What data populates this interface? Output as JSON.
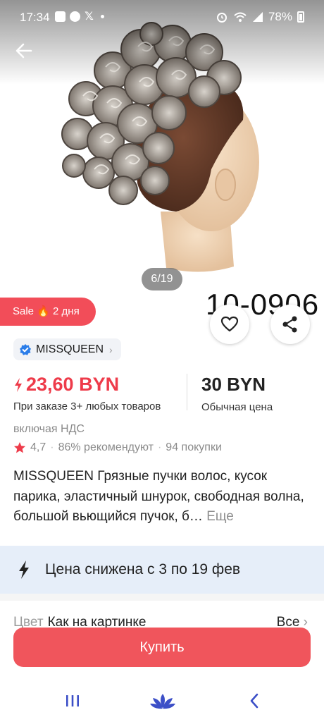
{
  "status_bar": {
    "time": "17:34",
    "battery": "78%"
  },
  "gallery": {
    "counter": "6/19",
    "watermark_text": "10-0906"
  },
  "sale_tag": {
    "label": "Sale 🔥 2 дня"
  },
  "store": {
    "name": "MISSQUEEN"
  },
  "price": {
    "sale": "23,60 BYN",
    "sale_note": "При заказе 3+ любых товаров",
    "regular": "30 BYN",
    "regular_note": "Обычная цена"
  },
  "vat": "включая НДС",
  "rating": {
    "value": "4,7",
    "recommend": "86% рекомендуют",
    "purchases": "94 покупки",
    "separator": "·"
  },
  "description": {
    "text": "MISSQUEEN Грязные пучки волос, кусок парика, эластичный шнурок, свободная волна, большой вьющийся пучок, б…",
    "more": "Еще"
  },
  "banner": {
    "text": "Цена снижена с 3 по 19 фев"
  },
  "color_row": {
    "label": "Цвет",
    "value": "Как на картинке",
    "all": "Все"
  },
  "buy_button": {
    "label": "Купить"
  },
  "colors": {
    "accent": "#ee3b4a",
    "buy": "#f0555c",
    "banner_bg": "#e6eef9",
    "verified": "#2b7de9"
  },
  "icons": [
    "arrow-left",
    "heart",
    "share",
    "verified-badge",
    "lightning",
    "star",
    "menu-lines",
    "lotus-home",
    "chevron-back"
  ]
}
